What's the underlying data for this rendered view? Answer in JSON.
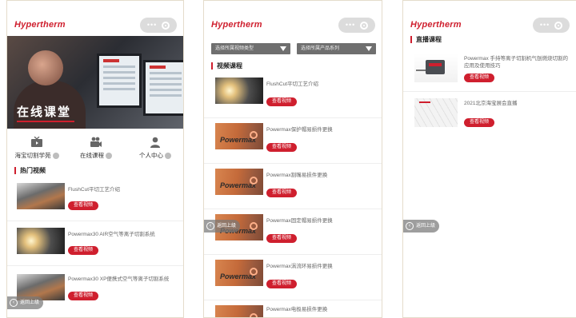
{
  "brand": {
    "logo_text": "Hypertherm",
    "accent": "#cf1f2e"
  },
  "phone1": {
    "banner_title": "在线课堂",
    "nav": [
      {
        "label": "海宝切割学苑",
        "icon": "tv-icon"
      },
      {
        "label": "在线课程",
        "icon": "video-camera-icon"
      },
      {
        "label": "个人中心",
        "icon": "person-icon"
      }
    ],
    "section_title": "热门视频",
    "videos": [
      {
        "title": "FlushCut平切工艺介绍",
        "button": "查看视频",
        "thumb": "machine"
      },
      {
        "title": "Powermax30 AIR空气等离子切割系统",
        "button": "查看视频",
        "thumb": "sparks"
      },
      {
        "title": "Powermax30 XP便携式空气等离子切割系统",
        "button": "查看视频",
        "thumb": "machine"
      }
    ],
    "back_label": "返回上级"
  },
  "phone2": {
    "dropdowns": [
      "选择所属视频类型",
      "选择所属产品系列"
    ],
    "section_title": "视频课程",
    "videos": [
      {
        "title": "FlushCut平切工艺介绍",
        "button": "查看视频",
        "thumb": "sparks"
      },
      {
        "title": "Powermax保护帽易损件更换",
        "button": "查看视频",
        "thumb": "powermax"
      },
      {
        "title": "Powermax割嘴易损件更换",
        "button": "查看视频",
        "thumb": "powermax"
      },
      {
        "title": "Powermax固定帽易损件更换",
        "button": "查看视频",
        "thumb": "powermax"
      },
      {
        "title": "Powermax涡流环易损件更换",
        "button": "查看视频",
        "thumb": "powermax"
      },
      {
        "title": "Powermax电极易损件更换",
        "button": "查看视频",
        "thumb": "powermax"
      }
    ],
    "powermax_text": "Powermax",
    "back_label": "返回上级"
  },
  "phone3": {
    "section_title": "直播课程",
    "lives": [
      {
        "title": "Powermax 手持等离子切割机气刨燃烧切割的应用及使用技巧",
        "button": "查看视频",
        "thumb": "unit"
      },
      {
        "title": "2021北京海宝展会直播",
        "button": "查看视频",
        "thumb": "hex"
      }
    ],
    "back_label": "返回上级"
  }
}
